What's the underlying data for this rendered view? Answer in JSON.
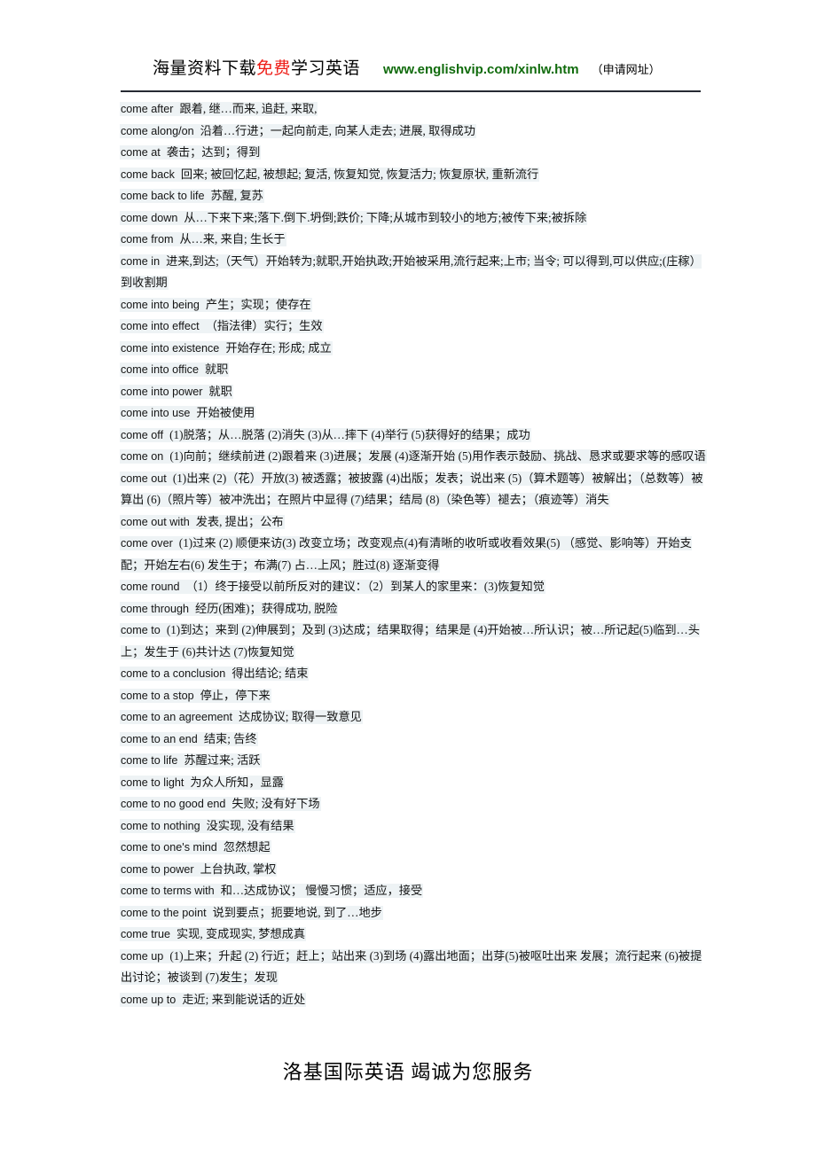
{
  "header": {
    "cn_lead": "海量资料下载",
    "cn_red": "免费",
    "cn_tail": "学习英语",
    "url": "www.englishvip.com/xinlw.htm",
    "note": "（申请网址）",
    "red_color": "#ee1c16",
    "url_color": "#106b0c"
  },
  "highlight_color": "#eef3f5",
  "entries": [
    {
      "term": "come after",
      "def": "跟着, 继…而来, 追赶, 来取,"
    },
    {
      "term": "come along/on",
      "def": "沿着…行进；一起向前走, 向某人走去; 进展, 取得成功"
    },
    {
      "term": "come at",
      "def": "袭击；达到；得到"
    },
    {
      "term": "come back",
      "def": "回来; 被回忆起, 被想起; 复活, 恢复知觉, 恢复活力; 恢复原状, 重新流行"
    },
    {
      "term": "come back to life",
      "def": "苏醒, 复苏"
    },
    {
      "term": "come down",
      "def": "从…下来下来;落下.倒下.坍倒;跌价; 下降;从城市到较小的地方;被传下来;被拆除"
    },
    {
      "term": "come from",
      "def": "从…来, 来自; 生长于"
    },
    {
      "term": "come in",
      "def": "进来,到达;（天气）开始转为;就职,开始执政;开始被采用,流行起来;上市; 当令; 可以得到,可以供应;(庄稼）到收割期"
    },
    {
      "term": "come into being",
      "def": "产生；实现；使存在"
    },
    {
      "term": "come into effect",
      "def": "（指法律）实行；生效"
    },
    {
      "term": "come into existence",
      "def": "开始存在; 形成; 成立"
    },
    {
      "term": "come into office",
      "def": "就职"
    },
    {
      "term": "come into power",
      "def": "就职"
    },
    {
      "term": "come into use",
      "def": "开始被使用"
    },
    {
      "term": "come off",
      "def": "(1)脱落；从…脱落 (2)消失 (3)从…摔下 (4)举行 (5)获得好的结果；成功"
    },
    {
      "term": "come on",
      "def": "(1)向前；继续前进 (2)跟着来 (3)进展；发展 (4)逐渐开始 (5)用作表示鼓励、挑战、恳求或要求等的感叹语"
    },
    {
      "term": "come out",
      "def": "(1)出来 (2)（花）开放(3) 被透露；被披露 (4)出版；发表；说出来 (5)（算术题等）被解出；（总数等）被算出 (6)（照片等）被冲洗出；在照片中显得 (7)结果；结局 (8)（染色等）褪去；（痕迹等）消失"
    },
    {
      "term": "come out with",
      "def": "发表, 提出；公布"
    },
    {
      "term": "come over",
      "def": "(1)过来 (2) 顺便来访(3) 改变立场；改变观点(4)有清晰的收听或收看效果(5) （感觉、影响等）开始支配；开始左右(6) 发生于；布满(7) 占…上风；胜过(8) 逐渐变得"
    },
    {
      "term": "come round",
      "def": "（1）终于接受以前所反对的建议：（2）到某人的家里来：(3)恢复知觉"
    },
    {
      "term": "come through",
      "def": "经历(困难)；获得成功, 脱险"
    },
    {
      "term": "come to",
      "def": "(1)到达；来到 (2)伸展到；及到 (3)达成；结果取得；结果是 (4)开始被…所认识；被…所记起(5)临到…头上；发生于 (6)共计达 (7)恢复知觉"
    },
    {
      "term": "come to a conclusion",
      "def": "得出结论; 结束"
    },
    {
      "term": "come to a stop",
      "def": "停止，停下来"
    },
    {
      "term": "come to an agreement",
      "def": "达成协议; 取得一致意见"
    },
    {
      "term": "come to an end",
      "def": "结束; 告终"
    },
    {
      "term": "come to life",
      "def": "苏醒过来; 活跃"
    },
    {
      "term": "come to light",
      "def": "为众人所知，显露"
    },
    {
      "term": "come to no good end",
      "def": "失败; 没有好下场"
    },
    {
      "term": "come to nothing",
      "def": "没实现, 没有结果"
    },
    {
      "term": "come to one's mind",
      "def": "忽然想起"
    },
    {
      "term": "come to power",
      "def": "上台执政, 掌权"
    },
    {
      "term": "come to terms with",
      "def": "和…达成协议； 慢慢习惯；适应，接受"
    },
    {
      "term": "come to the point",
      "def": "说到要点；扼要地说, 到了…地步"
    },
    {
      "term": "come true",
      "def": "实现, 变成现实, 梦想成真"
    },
    {
      "term": "come up",
      "def": "(1)上来；升起 (2) 行近；赶上；站出来 (3)到场 (4)露出地面；出芽(5)被呕吐出来 发展；流行起来 (6)被提出讨论；被谈到 (7)发生；发现"
    },
    {
      "term": "come up to",
      "def": "走近; 来到能说话的近处"
    }
  ],
  "footer": {
    "text": "洛基国际英语    竭诚为您服务"
  }
}
